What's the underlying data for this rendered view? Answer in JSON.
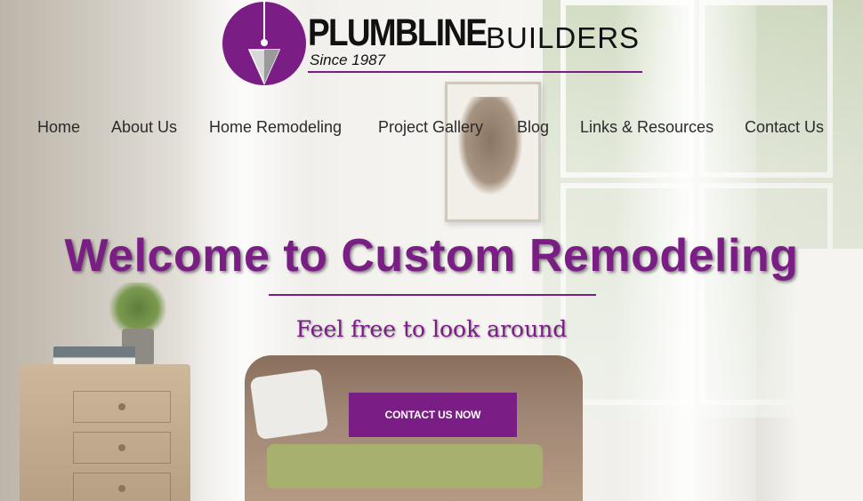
{
  "brand": {
    "name_bold": "PLUMBLINE",
    "name_light": "BUILDERS",
    "tagline": "Since 1987",
    "accent": "#7a1e86",
    "logo_icon": "plumb-bob-icon"
  },
  "nav": {
    "items": [
      {
        "label": "Home"
      },
      {
        "label": "About Us"
      },
      {
        "label": "Home Remodeling"
      },
      {
        "label": "Project Gallery"
      },
      {
        "label": "Blog"
      },
      {
        "label": "Links & Resources"
      },
      {
        "label": "Contact Us"
      }
    ]
  },
  "hero": {
    "title": "Welcome to Custom Remodeling",
    "subtitle": "Feel free to look around",
    "cta_label": "CONTACT US NOW"
  }
}
